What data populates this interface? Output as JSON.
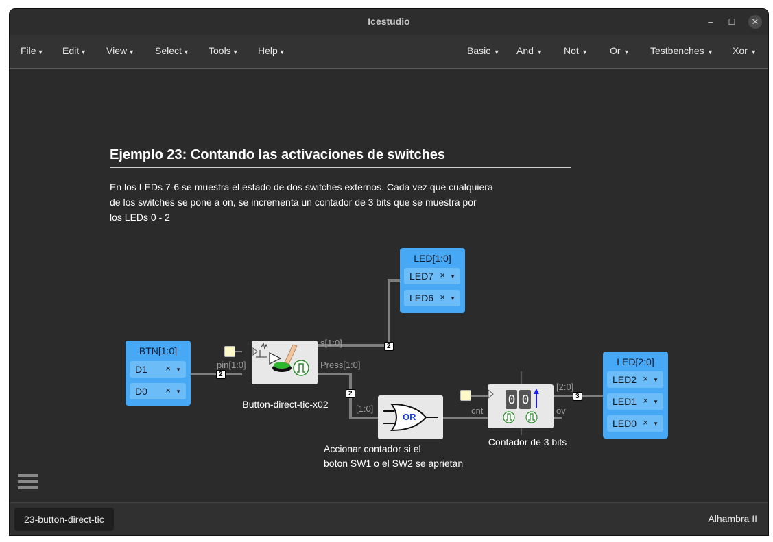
{
  "window": {
    "title": "Icestudio"
  },
  "menubar": {
    "left": [
      {
        "label": "File"
      },
      {
        "label": "Edit"
      },
      {
        "label": "View"
      },
      {
        "label": "Select"
      },
      {
        "label": "Tools"
      },
      {
        "label": "Help"
      }
    ],
    "right": [
      {
        "label": "Basic"
      },
      {
        "label": "And"
      },
      {
        "label": "Not"
      },
      {
        "label": "Or"
      },
      {
        "label": "Testbenches"
      },
      {
        "label": "Xor"
      }
    ]
  },
  "doc": {
    "heading": "Ejemplo 23: Contando las activaciones de switches",
    "lines": [
      "En los LEDs 7-6 se muestra el estado de dos switches externos. Cada vez que cualquiera",
      "de los switches se pone a on, se incrementa un contador de 3 bits que se muestra por",
      "los LEDs 0 - 2"
    ],
    "note": [
      "Accionar contador si el",
      "boton SW1 o el SW2 se aprietan"
    ]
  },
  "blocks": {
    "btn": {
      "title": "BTN[1:0]",
      "items": [
        {
          "name": "D1",
          "x": "×"
        },
        {
          "name": "D0",
          "x": "×"
        }
      ]
    },
    "led_hi": {
      "title": "LED[1:0]",
      "items": [
        {
          "name": "LED7",
          "x": "×"
        },
        {
          "name": "LED6",
          "x": "×"
        }
      ]
    },
    "led_lo": {
      "title": "LED[2:0]",
      "items": [
        {
          "name": "LED2",
          "x": "×"
        },
        {
          "name": "LED1",
          "x": "×"
        },
        {
          "name": "LED0",
          "x": "×"
        }
      ]
    },
    "button_module": {
      "label": "Button-direct-tic-x02",
      "in_port": "pin[1:0]",
      "out_s": "s[1:0]",
      "out_press": "Press[1:0]"
    },
    "or_gate": {
      "label": "OR",
      "in_port": "[1:0]"
    },
    "counter": {
      "label": "Contador de 3 bits",
      "in_port": "cnt",
      "out_bus": "[2:0]",
      "out_ov": "ov",
      "digits": [
        "0",
        "0"
      ]
    },
    "bus_widths": {
      "btn_to_button": "2",
      "s_to_led": "2",
      "press_to_or": "2",
      "counter_to_led": "3"
    }
  },
  "footer": {
    "tab": "23-button-direct-tic",
    "board": "Alhambra II"
  },
  "colors": {
    "io_block": "#47a8f5",
    "wire": "#7f7f7f",
    "canvas": "#2b2b2b"
  }
}
